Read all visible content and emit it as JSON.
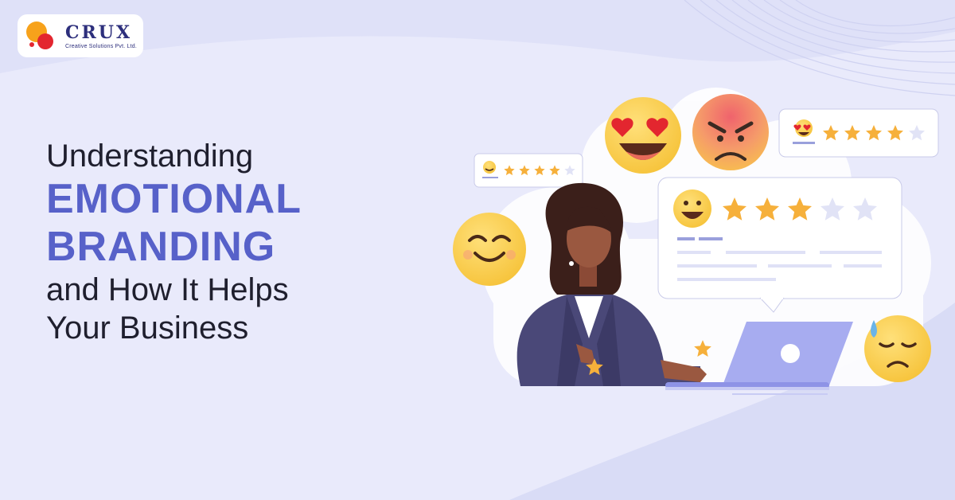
{
  "brand": {
    "name": "CRUX",
    "tagline": "Creative Solutions Pvt. Ltd.",
    "colors": {
      "orange": "#f7a21b",
      "red": "#e3262f",
      "navy": "#2d2f7c"
    }
  },
  "headline": {
    "line1": "Understanding",
    "line2": "EMOTIONAL",
    "line3": "BRANDING",
    "line4": "and How It Helps",
    "line5": "Your Business"
  },
  "colors": {
    "accent": "#5761c9",
    "background": "#e9eafb",
    "star": "#f6b03b"
  },
  "illustration": {
    "ratings": [
      {
        "emoji": "smiling-face",
        "stars_filled": 4,
        "stars_total": 5
      },
      {
        "emoji": "heart-eyes-face",
        "stars_filled": 4,
        "stars_total": 5
      },
      {
        "emoji": "grinning-face",
        "stars_filled": 3,
        "stars_total": 5
      }
    ],
    "floating_emojis": [
      "heart-eyes-face",
      "angry-face",
      "smiling-face",
      "sad-sweat-face"
    ]
  }
}
